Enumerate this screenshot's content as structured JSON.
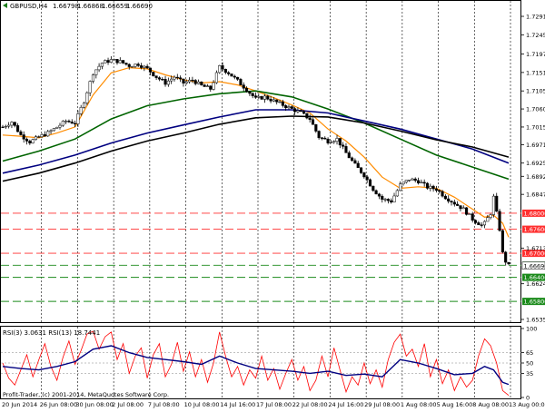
{
  "chart_data": [
    {
      "type": "candlestick",
      "header": {
        "symbol_tf": "GBPUSD,H4",
        "ohlc": [
          "1.66798",
          "1.66868",
          "1.66659",
          "1.66690"
        ]
      },
      "watermark": "Profit-Trader, (c) 2001-2014, MetaQuotes Software Corp.",
      "ylim": [
        1.6535,
        1.7325
      ],
      "y_ticks": [
        "1.72910",
        "1.72450",
        "1.71970",
        "1.71510",
        "1.71050",
        "1.70600",
        "1.70150",
        "1.69710",
        "1.69250",
        "1.68920",
        "1.68470",
        "1.67130",
        "1.66240",
        "1.65350"
      ],
      "x_ticks": [
        "20 Jun 2014",
        "26 Jun 08:00",
        "30 Jun 08:00",
        "2 Jul 08:00",
        "7 Jul 08:00",
        "10 Jul 08:00",
        "14 Jul 16:00",
        "17 Jul 08:00",
        "22 Jul 08:00",
        "24 Jul 16:00",
        "29 Jul 08:00",
        "1 Aug 08:00",
        "5 Aug 16:00",
        "8 Aug 08:00",
        "13 Aug 00:00"
      ],
      "horizontal_levels": [
        {
          "value": 1.68,
          "label": "1.68000",
          "kind": "resistance"
        },
        {
          "value": 1.676,
          "label": "1.67600",
          "kind": "resistance"
        },
        {
          "value": 1.67,
          "label": "1.67000",
          "kind": "resistance"
        },
        {
          "value": 1.667,
          "label": "1.66700",
          "kind": "support"
        },
        {
          "value": 1.664,
          "label": "1.66400",
          "kind": "support"
        },
        {
          "value": 1.658,
          "label": "1.65800",
          "kind": "support"
        }
      ],
      "current_price": {
        "value": 1.6669,
        "label": "1.66690"
      },
      "close_path": [
        [
          0,
          1.7015
        ],
        [
          3,
          1.7028
        ],
        [
          6,
          1.6995
        ],
        [
          9,
          1.6978
        ],
        [
          12,
          1.699
        ],
        [
          15,
          1.7
        ],
        [
          18,
          1.7015
        ],
        [
          21,
          1.703
        ],
        [
          24,
          1.7025
        ],
        [
          27,
          1.708
        ],
        [
          30,
          1.715
        ],
        [
          33,
          1.7175
        ],
        [
          36,
          1.7182
        ],
        [
          39,
          1.7178
        ],
        [
          42,
          1.7168
        ],
        [
          45,
          1.7172
        ],
        [
          48,
          1.716
        ],
        [
          51,
          1.714
        ],
        [
          54,
          1.7125
        ],
        [
          57,
          1.714
        ],
        [
          60,
          1.7125
        ],
        [
          63,
          1.7132
        ],
        [
          66,
          1.7118
        ],
        [
          69,
          1.711
        ],
        [
          72,
          1.7165
        ],
        [
          75,
          1.715
        ],
        [
          78,
          1.713
        ],
        [
          81,
          1.7108
        ],
        [
          84,
          1.7085
        ],
        [
          87,
          1.709
        ],
        [
          90,
          1.708
        ],
        [
          93,
          1.707
        ],
        [
          96,
          1.706
        ],
        [
          99,
          1.705
        ],
        [
          102,
          1.7035
        ],
        [
          105,
          1.699
        ],
        [
          108,
          1.698
        ],
        [
          111,
          1.6985
        ],
        [
          114,
          1.695
        ],
        [
          117,
          1.692
        ],
        [
          120,
          1.6895
        ],
        [
          123,
          1.686
        ],
        [
          126,
          1.6835
        ],
        [
          129,
          1.683
        ],
        [
          132,
          1.687
        ],
        [
          135,
          1.6885
        ],
        [
          138,
          1.688
        ],
        [
          141,
          1.6865
        ],
        [
          144,
          1.686
        ],
        [
          147,
          1.684
        ],
        [
          150,
          1.6825
        ],
        [
          153,
          1.681
        ],
        [
          156,
          1.6785
        ],
        [
          159,
          1.677
        ],
        [
          160,
          1.6775
        ],
        [
          162,
          1.68
        ],
        [
          163,
          1.684
        ],
        [
          164,
          1.68
        ],
        [
          165,
          1.676
        ],
        [
          166,
          1.67
        ],
        [
          167,
          1.668
        ],
        [
          168,
          1.6669
        ]
      ],
      "series": [
        {
          "name": "ma_fast",
          "color": "#ff8c00",
          "values": [
            [
              0,
              1.6995
            ],
            [
              6,
              1.6992
            ],
            [
              12,
              1.6988
            ],
            [
              18,
              1.7
            ],
            [
              24,
              1.7015
            ],
            [
              30,
              1.7095
            ],
            [
              36,
              1.715
            ],
            [
              42,
              1.7163
            ],
            [
              48,
              1.716
            ],
            [
              54,
              1.7145
            ],
            [
              60,
              1.7133
            ],
            [
              66,
              1.7125
            ],
            [
              72,
              1.7128
            ],
            [
              78,
              1.712
            ],
            [
              84,
              1.7105
            ],
            [
              90,
              1.7088
            ],
            [
              96,
              1.707
            ],
            [
              102,
              1.705
            ],
            [
              108,
              1.701
            ],
            [
              114,
              1.698
            ],
            [
              120,
              1.694
            ],
            [
              126,
              1.689
            ],
            [
              132,
              1.6862
            ],
            [
              138,
              1.6866
            ],
            [
              144,
              1.6862
            ],
            [
              150,
              1.684
            ],
            [
              156,
              1.681
            ],
            [
              160,
              1.679
            ],
            [
              163,
              1.6795
            ],
            [
              166,
              1.6775
            ],
            [
              168,
              1.674
            ]
          ]
        },
        {
          "name": "ma_green",
          "color": "#006400",
          "values": [
            [
              0,
              1.693
            ],
            [
              12,
              1.6955
            ],
            [
              24,
              1.6985
            ],
            [
              36,
              1.7035
            ],
            [
              48,
              1.7068
            ],
            [
              60,
              1.7085
            ],
            [
              72,
              1.7098
            ],
            [
              84,
              1.7105
            ],
            [
              96,
              1.709
            ],
            [
              108,
              1.706
            ],
            [
              120,
              1.7025
            ],
            [
              132,
              1.6985
            ],
            [
              144,
              1.6945
            ],
            [
              156,
              1.6915
            ],
            [
              168,
              1.6885
            ]
          ]
        },
        {
          "name": "ma_navy",
          "color": "#000080",
          "values": [
            [
              0,
              1.69
            ],
            [
              12,
              1.692
            ],
            [
              24,
              1.6945
            ],
            [
              36,
              1.6975
            ],
            [
              48,
              1.7
            ],
            [
              60,
              1.702
            ],
            [
              72,
              1.704
            ],
            [
              84,
              1.7058
            ],
            [
              96,
              1.7058
            ],
            [
              108,
              1.705
            ],
            [
              120,
              1.703
            ],
            [
              132,
              1.701
            ],
            [
              144,
              1.6985
            ],
            [
              156,
              1.696
            ],
            [
              168,
              1.6925
            ]
          ]
        },
        {
          "name": "ma_black",
          "color": "#000000",
          "values": [
            [
              0,
              1.688
            ],
            [
              12,
              1.69
            ],
            [
              24,
              1.6925
            ],
            [
              36,
              1.6955
            ],
            [
              48,
              1.698
            ],
            [
              60,
              1.7
            ],
            [
              72,
              1.7022
            ],
            [
              84,
              1.7038
            ],
            [
              96,
              1.7042
            ],
            [
              108,
              1.704
            ],
            [
              120,
              1.7025
            ],
            [
              132,
              1.7005
            ],
            [
              144,
              1.6983
            ],
            [
              156,
              1.6965
            ],
            [
              168,
              1.694
            ]
          ]
        }
      ]
    },
    {
      "type": "line",
      "title": "RSI(3) 3.0631  RSI(13) 18.7441",
      "ylim": [
        0,
        100
      ],
      "y_ticks": [
        "100",
        "65",
        "50",
        "35",
        "0"
      ],
      "levels": [
        65,
        50,
        35
      ],
      "series": [
        {
          "name": "RSI(3)",
          "color": "#ff0000",
          "values": [
            [
              0,
              50
            ],
            [
              2,
              28
            ],
            [
              4,
              18
            ],
            [
              6,
              40
            ],
            [
              8,
              62
            ],
            [
              10,
              30
            ],
            [
              12,
              55
            ],
            [
              14,
              78
            ],
            [
              16,
              45
            ],
            [
              18,
              25
            ],
            [
              20,
              58
            ],
            [
              22,
              82
            ],
            [
              24,
              48
            ],
            [
              26,
              68
            ],
            [
              28,
              92
            ],
            [
              30,
              96
            ],
            [
              32,
              70
            ],
            [
              34,
              88
            ],
            [
              36,
              95
            ],
            [
              38,
              55
            ],
            [
              40,
              78
            ],
            [
              42,
              35
            ],
            [
              44,
              60
            ],
            [
              46,
              72
            ],
            [
              48,
              28
            ],
            [
              50,
              62
            ],
            [
              52,
              78
            ],
            [
              54,
              30
            ],
            [
              56,
              48
            ],
            [
              58,
              80
            ],
            [
              60,
              38
            ],
            [
              62,
              66
            ],
            [
              64,
              30
            ],
            [
              66,
              55
            ],
            [
              68,
              22
            ],
            [
              70,
              50
            ],
            [
              72,
              95
            ],
            [
              74,
              60
            ],
            [
              76,
              30
            ],
            [
              78,
              45
            ],
            [
              80,
              18
            ],
            [
              82,
              40
            ],
            [
              84,
              28
            ],
            [
              86,
              60
            ],
            [
              88,
              25
            ],
            [
              90,
              42
            ],
            [
              92,
              12
            ],
            [
              94,
              35
            ],
            [
              96,
              55
            ],
            [
              98,
              25
            ],
            [
              100,
              45
            ],
            [
              102,
              10
            ],
            [
              104,
              25
            ],
            [
              106,
              60
            ],
            [
              108,
              30
            ],
            [
              110,
              72
            ],
            [
              112,
              40
            ],
            [
              114,
              8
            ],
            [
              116,
              30
            ],
            [
              118,
              18
            ],
            [
              120,
              50
            ],
            [
              122,
              20
            ],
            [
              124,
              40
            ],
            [
              126,
              15
            ],
            [
              128,
              55
            ],
            [
              130,
              80
            ],
            [
              132,
              92
            ],
            [
              134,
              60
            ],
            [
              136,
              70
            ],
            [
              138,
              45
            ],
            [
              140,
              78
            ],
            [
              142,
              30
            ],
            [
              144,
              55
            ],
            [
              146,
              20
            ],
            [
              148,
              40
            ],
            [
              150,
              10
            ],
            [
              152,
              30
            ],
            [
              154,
              15
            ],
            [
              156,
              25
            ],
            [
              158,
              60
            ],
            [
              160,
              85
            ],
            [
              162,
              75
            ],
            [
              164,
              50
            ],
            [
              166,
              10
            ],
            [
              168,
              3
            ]
          ]
        },
        {
          "name": "RSI(13)",
          "color": "#000080",
          "values": [
            [
              0,
              45
            ],
            [
              6,
              42
            ],
            [
              12,
              40
            ],
            [
              18,
              45
            ],
            [
              24,
              52
            ],
            [
              30,
              70
            ],
            [
              36,
              75
            ],
            [
              42,
              65
            ],
            [
              48,
              58
            ],
            [
              54,
              55
            ],
            [
              60,
              52
            ],
            [
              66,
              48
            ],
            [
              72,
              60
            ],
            [
              78,
              50
            ],
            [
              84,
              42
            ],
            [
              90,
              40
            ],
            [
              96,
              38
            ],
            [
              102,
              35
            ],
            [
              108,
              38
            ],
            [
              114,
              32
            ],
            [
              120,
              34
            ],
            [
              126,
              30
            ],
            [
              132,
              55
            ],
            [
              138,
              50
            ],
            [
              144,
              42
            ],
            [
              150,
              33
            ],
            [
              156,
              35
            ],
            [
              160,
              45
            ],
            [
              163,
              40
            ],
            [
              166,
              22
            ],
            [
              168,
              19
            ]
          ]
        }
      ]
    }
  ]
}
